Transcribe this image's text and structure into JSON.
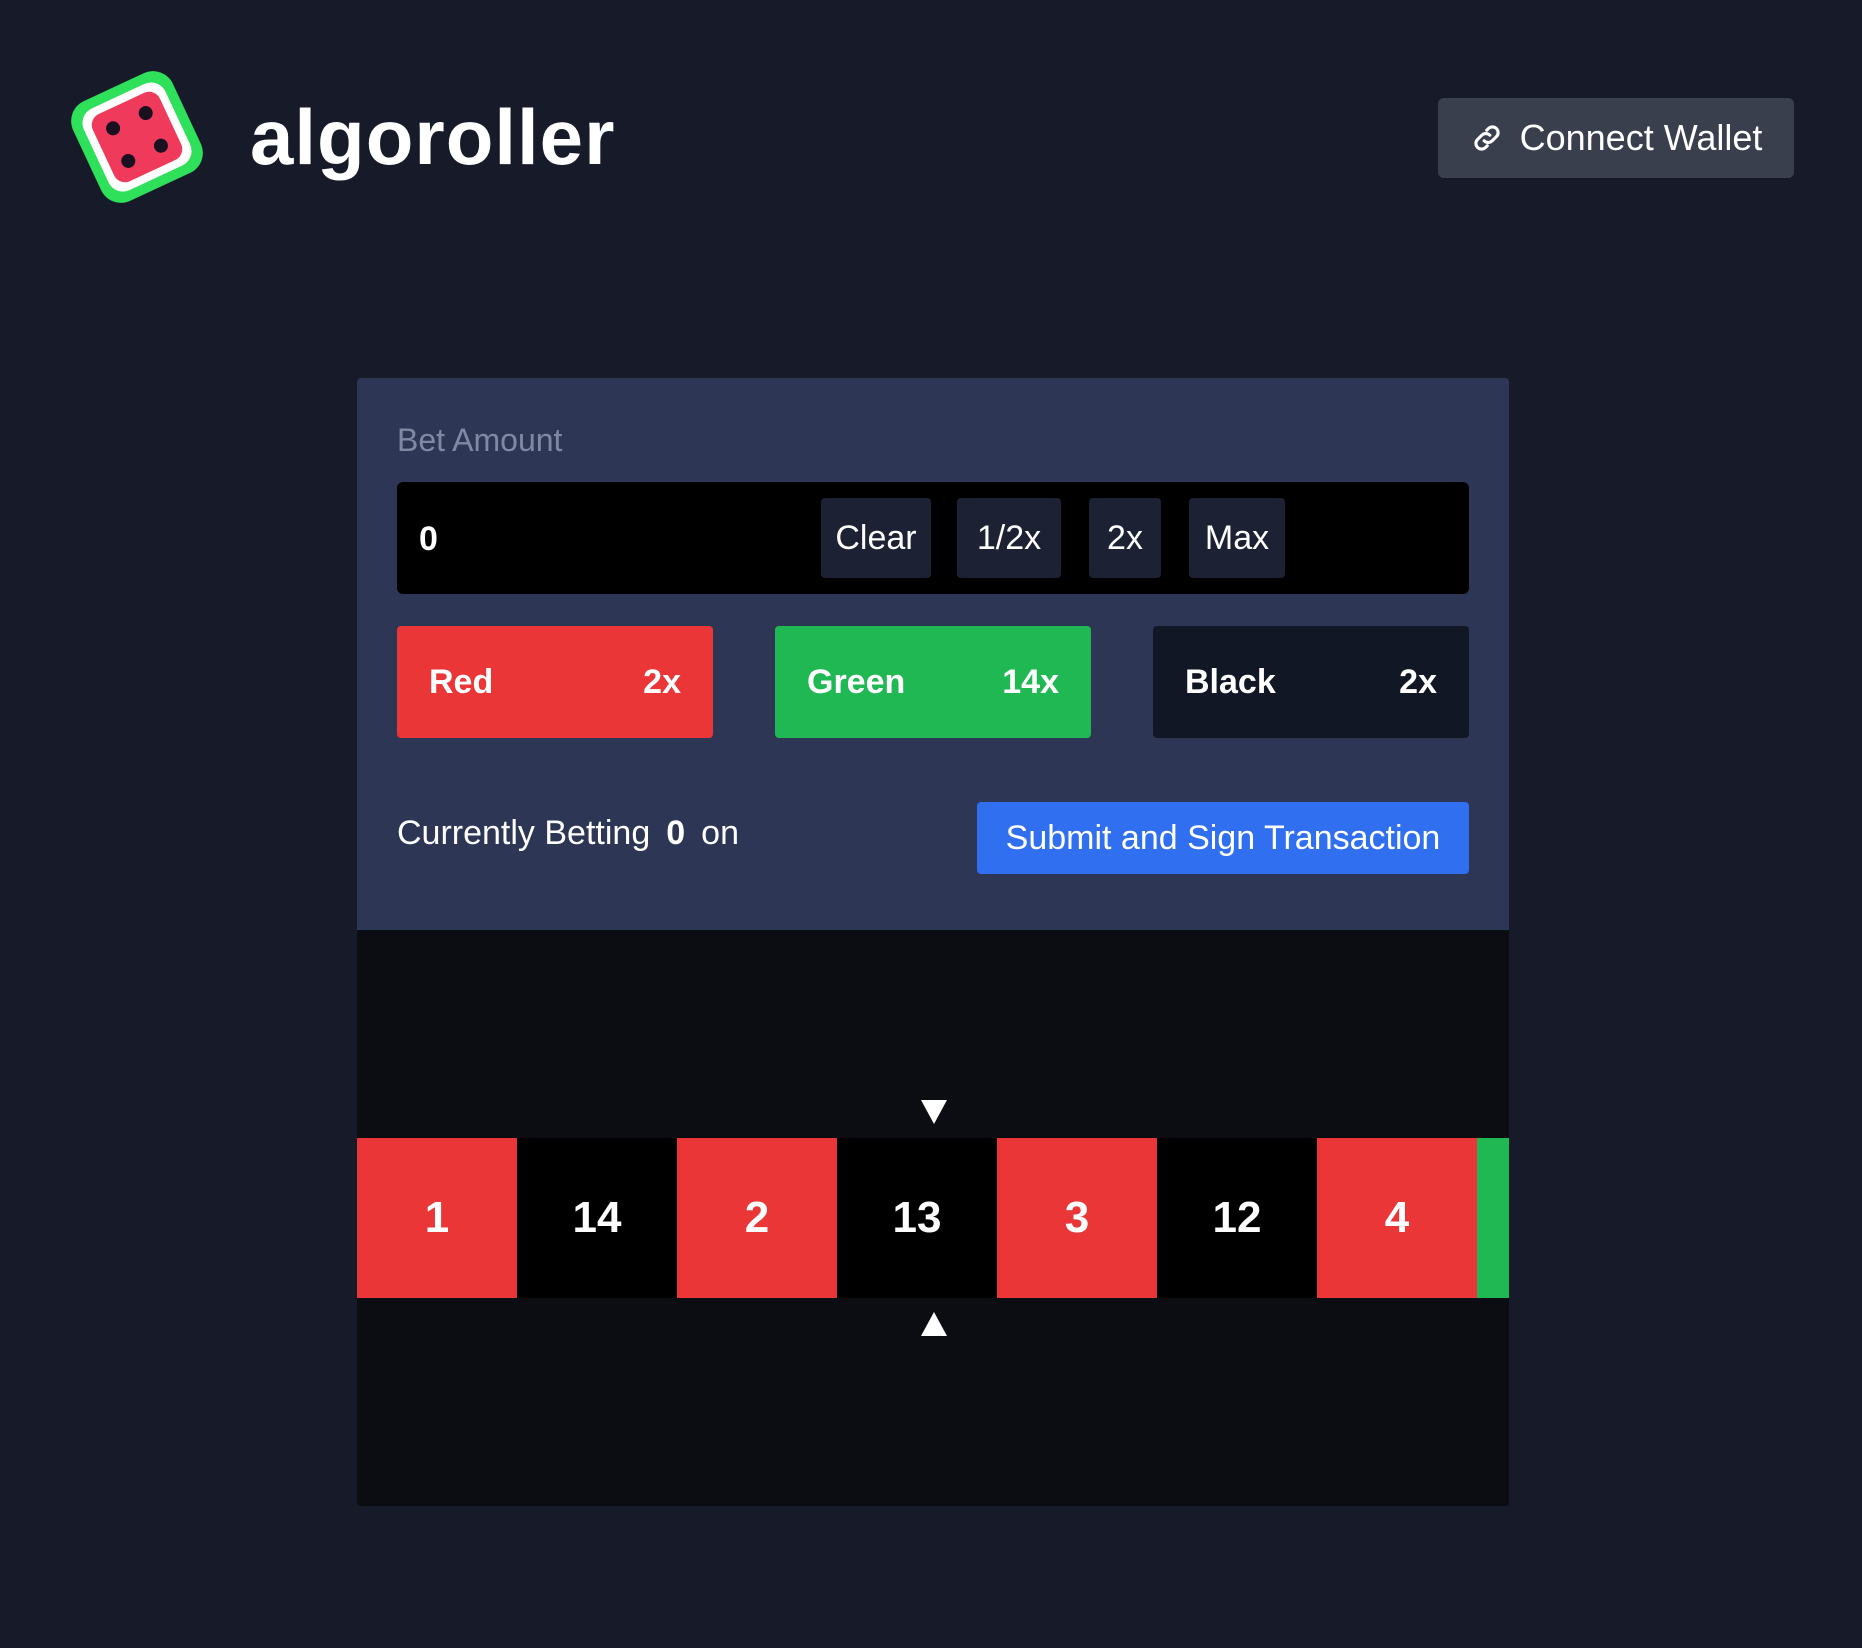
{
  "header": {
    "brand_name": "algoroller",
    "connect_wallet_label": "Connect Wallet",
    "logo_icon": "dice-icon",
    "link_icon": "link-icon"
  },
  "bet": {
    "label": "Bet Amount",
    "amount_value": "0",
    "buttons": {
      "clear": "Clear",
      "half": "1/2x",
      "double": "2x",
      "max": "Max"
    }
  },
  "colors": [
    {
      "name": "Red",
      "multiplier": "2x",
      "color": "#ea3636"
    },
    {
      "name": "Green",
      "multiplier": "14x",
      "color": "#1fb853"
    },
    {
      "name": "Black",
      "multiplier": "2x",
      "color": "#121725"
    }
  ],
  "status": {
    "prefix": "Currently Betting",
    "amount": "0",
    "suffix": "on"
  },
  "submit_label": "Submit and Sign Transaction",
  "roulette": {
    "cells": [
      {
        "number": "1",
        "color": "red"
      },
      {
        "number": "14",
        "color": "black"
      },
      {
        "number": "2",
        "color": "red"
      },
      {
        "number": "13",
        "color": "black"
      },
      {
        "number": "3",
        "color": "red"
      },
      {
        "number": "12",
        "color": "black"
      },
      {
        "number": "4",
        "color": "red"
      },
      {
        "number": "",
        "color": "green"
      }
    ]
  },
  "theme": {
    "background": "#171b29",
    "panel": "#2e3655",
    "accent_blue": "#2f6ff0",
    "red": "#ea3636",
    "green": "#1fb853"
  }
}
